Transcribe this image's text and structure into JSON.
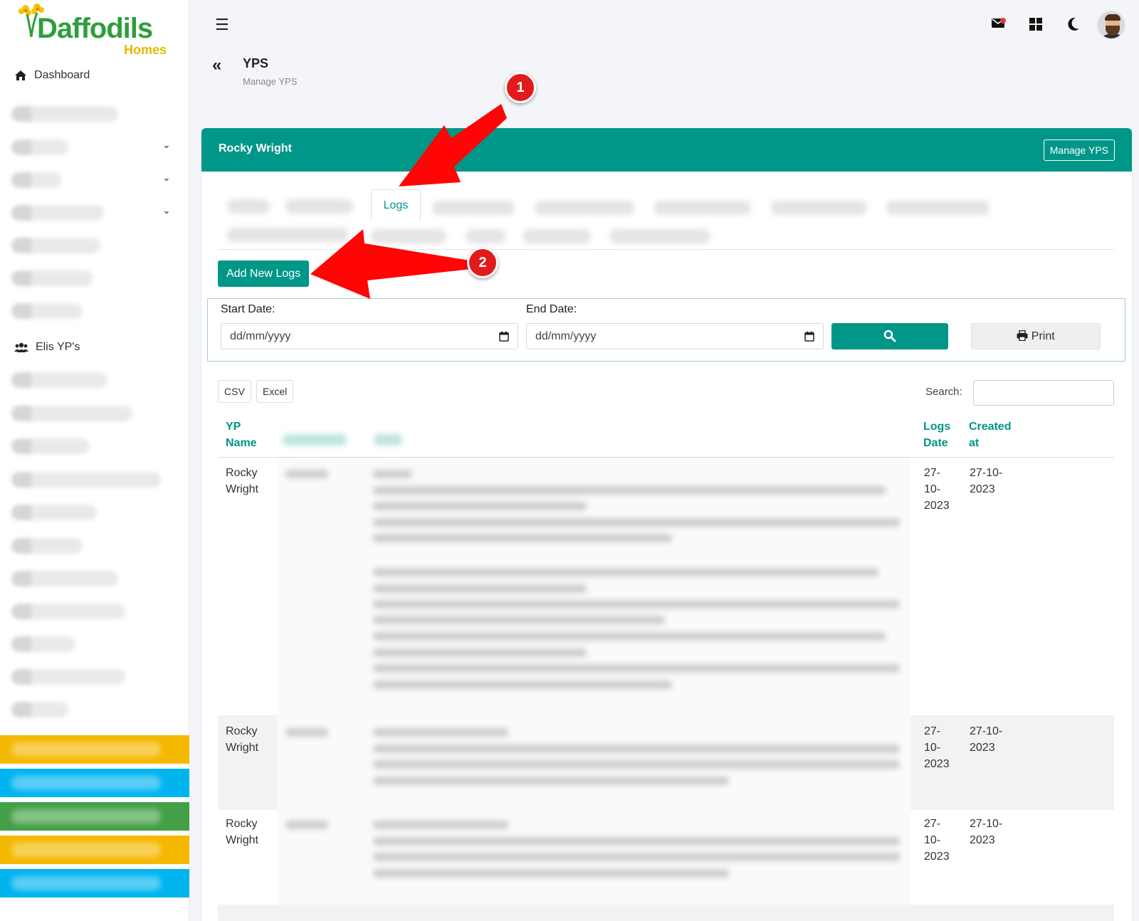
{
  "sidebar": {
    "logo": {
      "brand": "Daffodils",
      "sub": "Homes"
    },
    "items": [
      {
        "label": "Dashboard",
        "icon": "home-icon"
      },
      {
        "label": "Elis YP's",
        "icon": "users-icon"
      }
    ],
    "color_bars": [
      "#f5b800",
      "#00b4f0",
      "#43a047",
      "#f5b800",
      "#00b4f0"
    ]
  },
  "topbar": {
    "icons": [
      "menu-icon",
      "mail-icon",
      "grid-icon",
      "moon-icon",
      "avatar"
    ]
  },
  "page": {
    "title": "YPS",
    "subtitle": "Manage YPS"
  },
  "card": {
    "title": "Rocky Wright",
    "manage_button": "Manage YPS",
    "active_tab": "Logs",
    "add_button": "Add New Logs",
    "accent": "#009688"
  },
  "filter": {
    "start_label": "Start Date:",
    "end_label": "End Date:",
    "start_placeholder": "dd/mm/yyyy",
    "end_placeholder": "dd/mm/yyyy",
    "print_label": "Print"
  },
  "table": {
    "export_buttons": [
      "CSV",
      "Excel"
    ],
    "search_label": "Search:",
    "headers": {
      "yp_name": [
        "YP",
        "Name"
      ],
      "logs_date": [
        "Logs",
        "Date"
      ],
      "created_at": [
        "Created",
        "at"
      ]
    },
    "rows": [
      {
        "yp_name": [
          "Rocky",
          "Wright"
        ],
        "logs_date": [
          "27-",
          "10-",
          "2023"
        ],
        "created_at": [
          "27-10-",
          "2023"
        ]
      },
      {
        "yp_name": [
          "Rocky",
          "Wright"
        ],
        "logs_date": [
          "27-",
          "10-",
          "2023"
        ],
        "created_at": [
          "27-10-",
          "2023"
        ]
      },
      {
        "yp_name": [
          "Rocky",
          "Wright"
        ],
        "logs_date": [
          "27-",
          "10-",
          "2023"
        ],
        "created_at": [
          "27-10-",
          "2023"
        ]
      }
    ]
  },
  "annotations": {
    "callout_1": "1",
    "callout_2": "2",
    "color": "#e11b1b"
  }
}
